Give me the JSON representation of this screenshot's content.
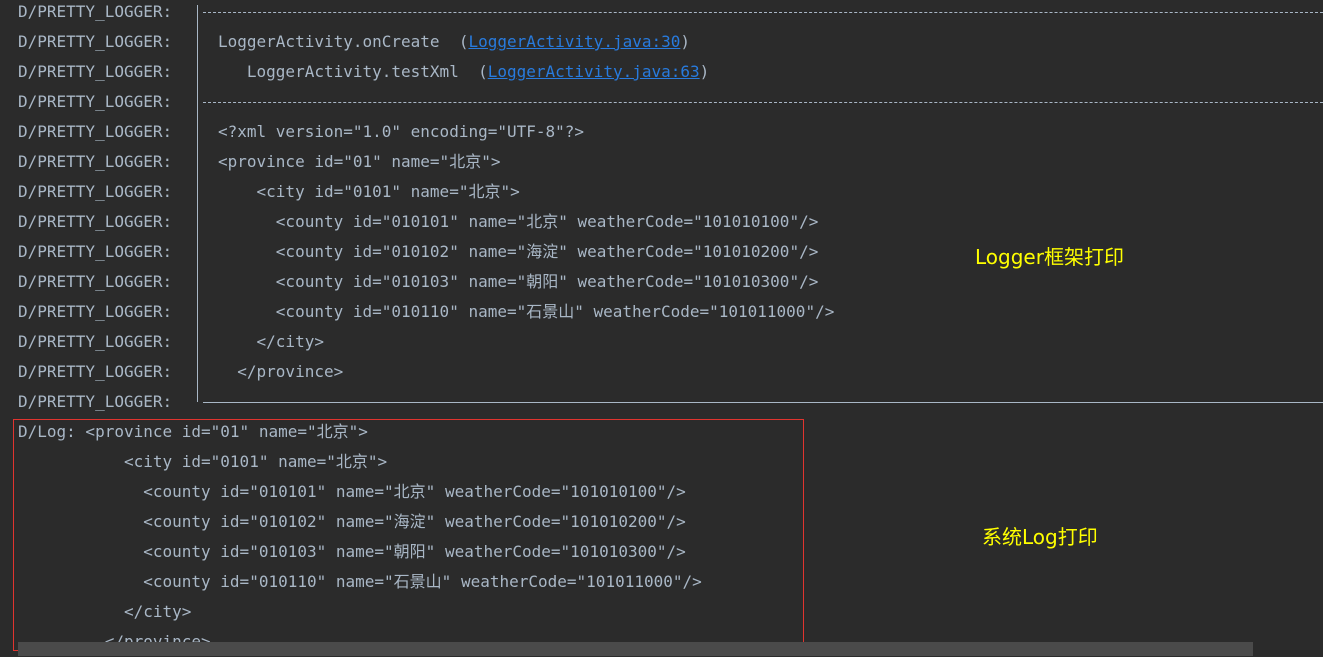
{
  "tag": "D/PRETTY_LOGGER:",
  "pretty_lines": [
    {
      "kind": "top"
    },
    {
      "kind": "call",
      "text": "LoggerActivity.onCreate  (",
      "link": "LoggerActivity.java:30",
      "after": ")"
    },
    {
      "kind": "call",
      "text": "   LoggerActivity.testXml  (",
      "link": "LoggerActivity.java:63",
      "after": ")"
    },
    {
      "kind": "mid"
    },
    {
      "kind": "text",
      "text": "<?xml version=\"1.0\" encoding=\"UTF-8\"?>"
    },
    {
      "kind": "text",
      "text": "<province id=\"01\" name=\"北京\">"
    },
    {
      "kind": "text",
      "text": "    <city id=\"0101\" name=\"北京\">"
    },
    {
      "kind": "text",
      "text": "      <county id=\"010101\" name=\"北京\" weatherCode=\"101010100\"/>"
    },
    {
      "kind": "text",
      "text": "      <county id=\"010102\" name=\"海淀\" weatherCode=\"101010200\"/>"
    },
    {
      "kind": "text",
      "text": "      <county id=\"010103\" name=\"朝阳\" weatherCode=\"101010300\"/>"
    },
    {
      "kind": "text",
      "text": "      <county id=\"010110\" name=\"石景山\" weatherCode=\"101011000\"/>"
    },
    {
      "kind": "text",
      "text": "    </city>"
    },
    {
      "kind": "text",
      "text": "  </province>"
    },
    {
      "kind": "bottom"
    }
  ],
  "syslog_lines": [
    "D/Log: <province id=\"01\" name=\"北京\">",
    "           <city id=\"0101\" name=\"北京\">",
    "             <county id=\"010101\" name=\"北京\" weatherCode=\"101010100\"/>",
    "             <county id=\"010102\" name=\"海淀\" weatherCode=\"101010200\"/>",
    "             <county id=\"010103\" name=\"朝阳\" weatherCode=\"101010300\"/>",
    "             <county id=\"010110\" name=\"石景山\" weatherCode=\"101011000\"/>",
    "           </city>",
    "         </province>"
  ],
  "annotations": {
    "logger": "Logger框架打印",
    "system": "系统Log打印"
  },
  "colors": {
    "background": "#2b2b2b",
    "text": "#a9b7c6",
    "link": "#287bde",
    "annotation": "#ffff00",
    "highlight_box": "#e0342f"
  }
}
